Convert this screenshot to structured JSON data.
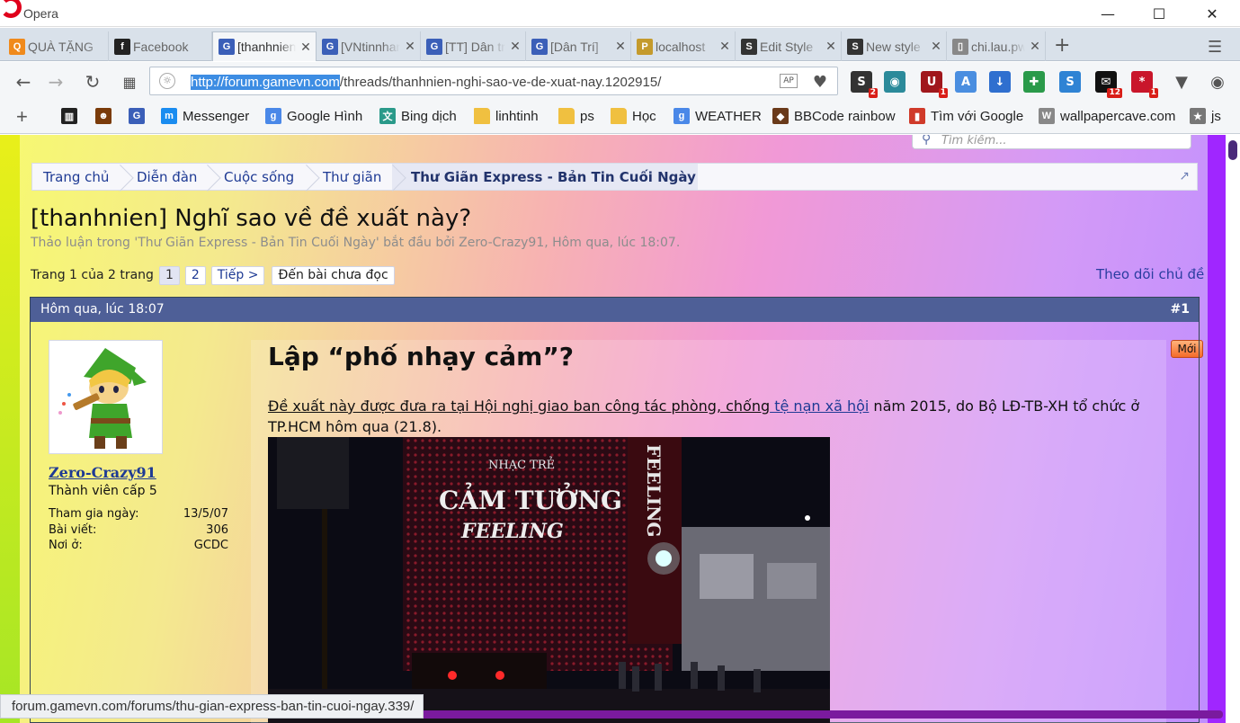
{
  "window": {
    "app_title": "Opera"
  },
  "tabs": [
    {
      "label": "QUÀ TẶNG",
      "color": "#f08a1c",
      "glyph": "Q",
      "active": false
    },
    {
      "label": "Facebook",
      "color": "#222222",
      "glyph": "f",
      "active": false
    },
    {
      "label": "[thanhnien]",
      "color": "#3b5fb8",
      "glyph": "G",
      "active": true
    },
    {
      "label": "[VNtinnhanh]",
      "color": "#3b5fb8",
      "glyph": "G",
      "active": false
    },
    {
      "label": "[TT] Dân trí",
      "color": "#3b5fb8",
      "glyph": "G",
      "active": false
    },
    {
      "label": "[Dân Trí]",
      "color": "#3b5fb8",
      "glyph": "G",
      "active": false
    },
    {
      "label": "localhost",
      "color": "#c49a2c",
      "glyph": "P",
      "active": false
    },
    {
      "label": "Edit Style",
      "color": "#333333",
      "glyph": "S",
      "active": false
    },
    {
      "label": "New style",
      "color": "#333333",
      "glyph": "S",
      "active": false
    },
    {
      "label": "chi.lau.pw",
      "color": "#888888",
      "glyph": "▯",
      "active": false
    }
  ],
  "address": {
    "url_host": "http://forum.gamevn.com",
    "url_path": "/threads/thanhnien-nghi-sao-ve-de-xuat-nay.1202915/"
  },
  "extensions": [
    {
      "name": "stylish-ext",
      "glyph": "S",
      "color": "#333333",
      "badge": "2"
    },
    {
      "name": "spy-ext",
      "glyph": "◉",
      "color": "#2b8a9a",
      "badge": ""
    },
    {
      "name": "ublock-ext",
      "glyph": "U",
      "color": "#a0171c",
      "badge": "1"
    },
    {
      "name": "translate-ext",
      "glyph": "A",
      "color": "#4a8ee0",
      "badge": ""
    },
    {
      "name": "download-ext",
      "glyph": "↓",
      "color": "#2f6fcf",
      "badge": ""
    },
    {
      "name": "save-ext",
      "glyph": "✚",
      "color": "#2a9a4a",
      "badge": ""
    },
    {
      "name": "stylus-ext",
      "glyph": "S",
      "color": "#2f83d4",
      "badge": ""
    },
    {
      "name": "mail-ext",
      "glyph": "✉",
      "color": "#111111",
      "badge": "12"
    },
    {
      "name": "lastpass-ext",
      "glyph": "*",
      "color": "#c9162b",
      "badge": "1"
    }
  ],
  "bookmarks": [
    {
      "label": "",
      "glyph": "▥",
      "color": "#222222",
      "folder": false
    },
    {
      "label": "",
      "glyph": "☻",
      "color": "#7a3b0a",
      "folder": false
    },
    {
      "label": "",
      "glyph": "G",
      "color": "#3b5fb8",
      "folder": false
    },
    {
      "label": "Messenger",
      "glyph": "m",
      "color": "#1a8cf0",
      "folder": false
    },
    {
      "label": "Google Hình",
      "glyph": "g",
      "color": "#4a88e8",
      "folder": false
    },
    {
      "label": "Bing dịch",
      "glyph": "文",
      "color": "#2a9a8a",
      "folder": false
    },
    {
      "label": "linhtinh",
      "glyph": "",
      "color": "#f0c040",
      "folder": true
    },
    {
      "label": "ps",
      "glyph": "",
      "color": "#f0c040",
      "folder": true
    },
    {
      "label": "Học",
      "glyph": "",
      "color": "#f0c040",
      "folder": true
    },
    {
      "label": "WEATHER",
      "glyph": "g",
      "color": "#4a88e8",
      "folder": false
    },
    {
      "label": "BBCode rainbow",
      "glyph": "◆",
      "color": "#6a3a1a",
      "folder": false
    },
    {
      "label": "Tìm với Google",
      "glyph": "▮",
      "color": "#d03a2a",
      "folder": false
    },
    {
      "label": "wallpapercave.com",
      "glyph": "W",
      "color": "#888888",
      "folder": false
    },
    {
      "label": "js",
      "glyph": "★",
      "color": "#777777",
      "folder": false
    }
  ],
  "forum": {
    "search_placeholder": "Tìm kiếm...",
    "breadcrumb": [
      "Trang chủ",
      "Diễn đàn",
      "Cuộc sống",
      "Thư giãn",
      "Thư Giãn Express - Bản Tin Cuối Ngày"
    ],
    "thread_title": "[thanhnien] Nghĩ sao về đề xuất này?",
    "thread_meta": "Thảo luận trong 'Thư Giãn Express - Bản Tin Cuối Ngày' bắt đầu bởi Zero-Crazy91, Hôm qua, lúc 18:07.",
    "pager": {
      "label": "Trang 1 của 2 trang",
      "pages": [
        "1",
        "2"
      ],
      "next": "Tiếp >",
      "unread": "Đến bài chưa đọc"
    },
    "follow": "Theo dõi chủ đề",
    "post": {
      "date": "Hôm qua, lúc 18:07",
      "number": "#1",
      "new_badge": "Mới",
      "user": {
        "name": "Zero-Crazy91",
        "rank": "Thành viên cấp 5",
        "stats": [
          {
            "label": "Tham gia ngày:",
            "value": "13/5/07"
          },
          {
            "label": "Bài viết:",
            "value": "306"
          },
          {
            "label": "Nơi ở:",
            "value": "GCDC"
          }
        ]
      },
      "title": "Lập “phố nhạy cảm”?",
      "body_1": "Đề xuất này được đưa ra tại Hội nghị giao ban công tác phòng, chống",
      "body_link": " tệ nạn xã hội",
      "body_2": " năm 2015, do Bộ LĐ-TB-XH tổ chức ở TP.HCM hôm qua (21.8).",
      "photo_sign_1": "NHẠC TRẺ",
      "photo_sign_2": "CẢM TƯỞNG",
      "photo_sign_3": "FEELING",
      "photo_sign_4": "FEELING"
    }
  },
  "status_url": "forum.gamevn.com/forums/thu-gian-express-ban-tin-cuoi-ngay.339/"
}
